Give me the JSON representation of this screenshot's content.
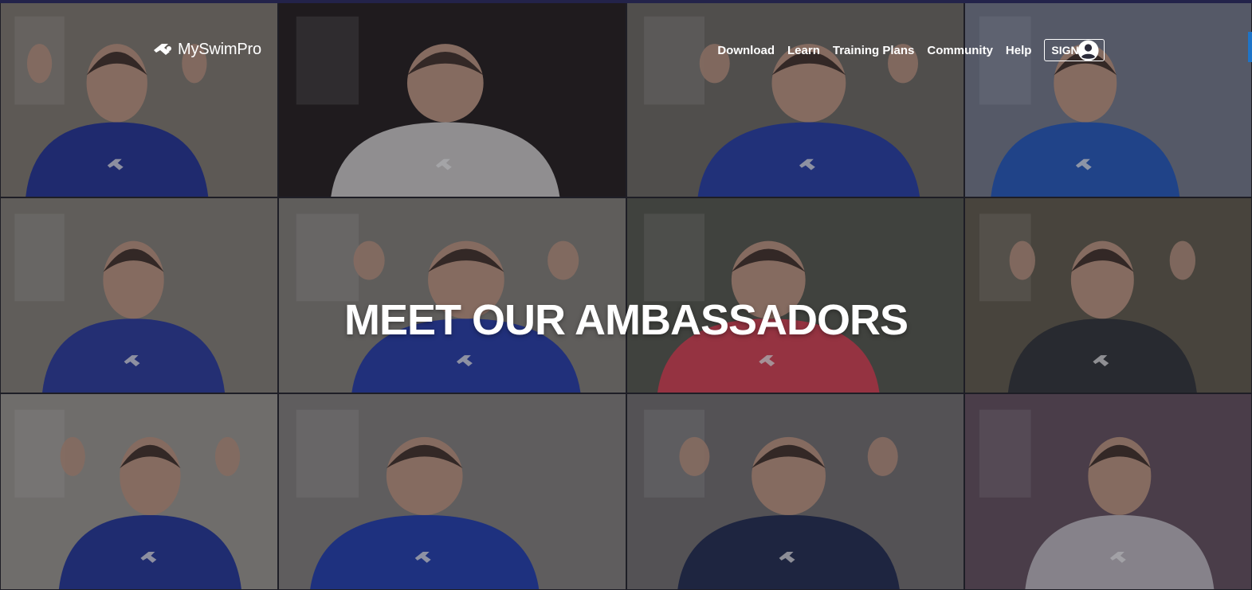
{
  "brand": {
    "name": "MySwimPro",
    "logo_icon": "swimmer-logo-icon"
  },
  "nav": {
    "links": [
      {
        "label": "Download"
      },
      {
        "label": "Learn"
      },
      {
        "label": "Training Plans"
      },
      {
        "label": "Community"
      },
      {
        "label": "Help"
      }
    ],
    "signup_label": "SIGN UP",
    "account_icon": "user-account-icon"
  },
  "hero": {
    "title": "MEET OUR AMBASSADORS"
  },
  "colors": {
    "accent": "#1e74c8",
    "shirt_blue": "#2a3aa8",
    "text": "#ffffff"
  }
}
